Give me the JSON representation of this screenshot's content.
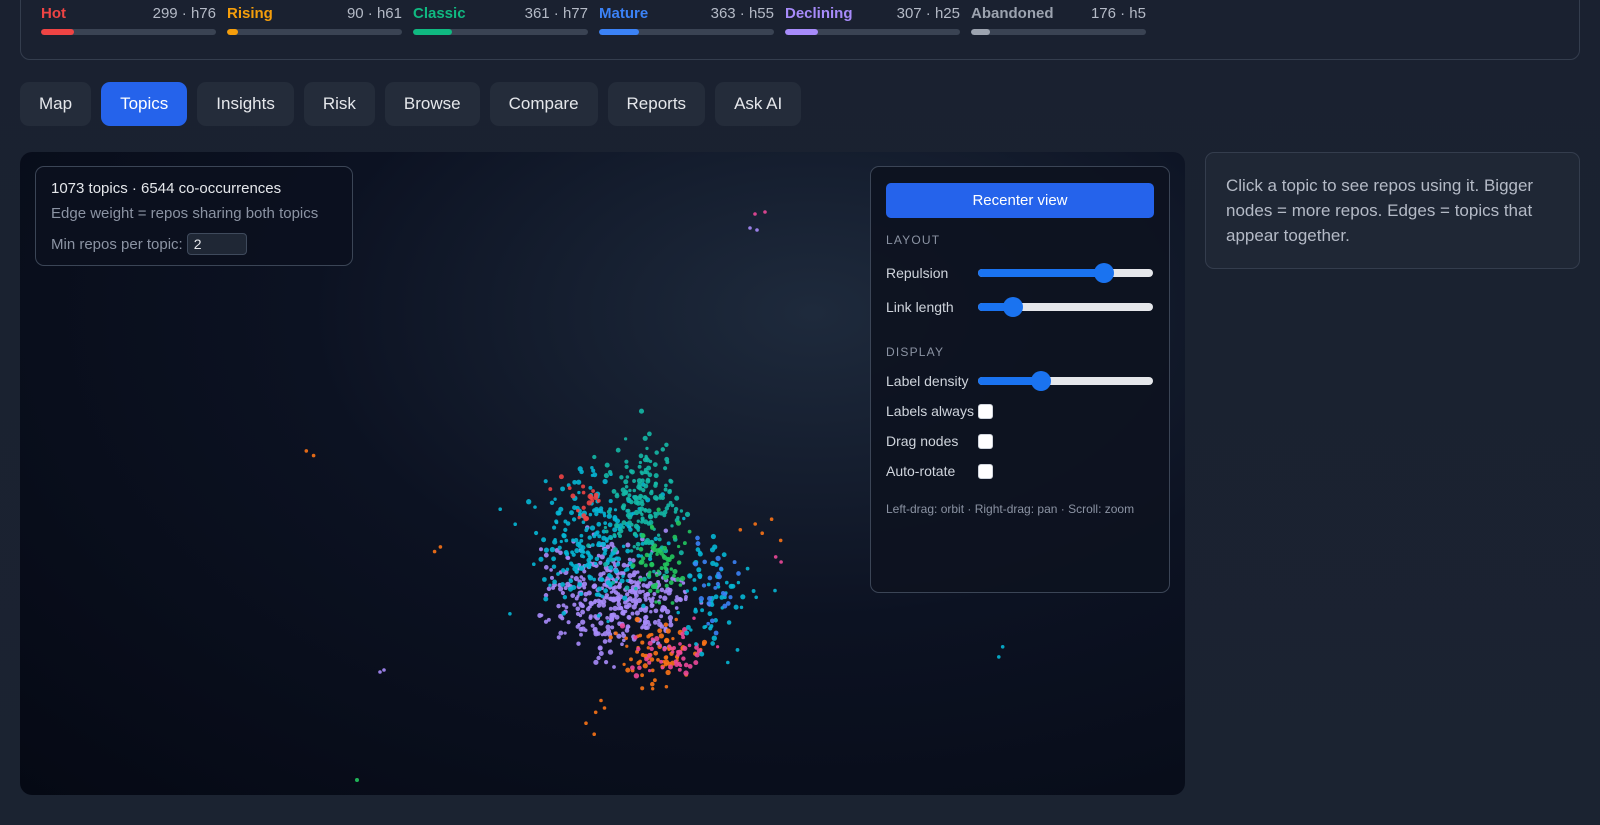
{
  "stages": [
    {
      "name": "Hot",
      "count": "299 · h76",
      "color": "#ef4444",
      "fill": 0.19
    },
    {
      "name": "Rising",
      "count": "90 · h61",
      "color": "#f59e0b",
      "fill": 0.06
    },
    {
      "name": "Classic",
      "count": "361 · h77",
      "color": "#10b981",
      "fill": 0.22
    },
    {
      "name": "Mature",
      "count": "363 · h55",
      "color": "#3b82f6",
      "fill": 0.23
    },
    {
      "name": "Declining",
      "count": "307 · h25",
      "color": "#a78bfa",
      "fill": 0.19
    },
    {
      "name": "Abandoned",
      "count": "176 · h5",
      "color": "#9ca3af",
      "fill": 0.11
    }
  ],
  "tabs": [
    {
      "label": "Map"
    },
    {
      "label": "Topics",
      "active": true
    },
    {
      "label": "Insights"
    },
    {
      "label": "Risk"
    },
    {
      "label": "Browse"
    },
    {
      "label": "Compare"
    },
    {
      "label": "Reports"
    },
    {
      "label": "Ask AI"
    }
  ],
  "graph": {
    "summary": "1073 topics · 6544 co-occurrences",
    "edge_note": "Edge weight = repos sharing both topics",
    "min_label": "Min repos per topic:",
    "min_value": "2"
  },
  "controls": {
    "recenter_label": "Recenter view",
    "layout_section": "LAYOUT",
    "repulsion_label": "Repulsion",
    "repulsion_value": 0.72,
    "link_length_label": "Link length",
    "link_length_value": 0.2,
    "display_section": "DISPLAY",
    "label_density_label": "Label density",
    "label_density_value": 0.36,
    "labels_always_label": "Labels always",
    "labels_always_checked": false,
    "drag_nodes_label": "Drag nodes",
    "drag_nodes_checked": false,
    "auto_rotate_label": "Auto-rotate",
    "auto_rotate_checked": false,
    "hint": "Left-drag: orbit · Right-drag: pan · Scroll: zoom"
  },
  "help_text": "Click a topic to see repos using it. Bigger nodes = more repos. Edges = topics that appear together.",
  "node_colors": [
    "#a78bfa",
    "#06b6d4",
    "#14b8a6",
    "#22c55e",
    "#f97316",
    "#ec4899",
    "#ef4444",
    "#3b82f6"
  ]
}
